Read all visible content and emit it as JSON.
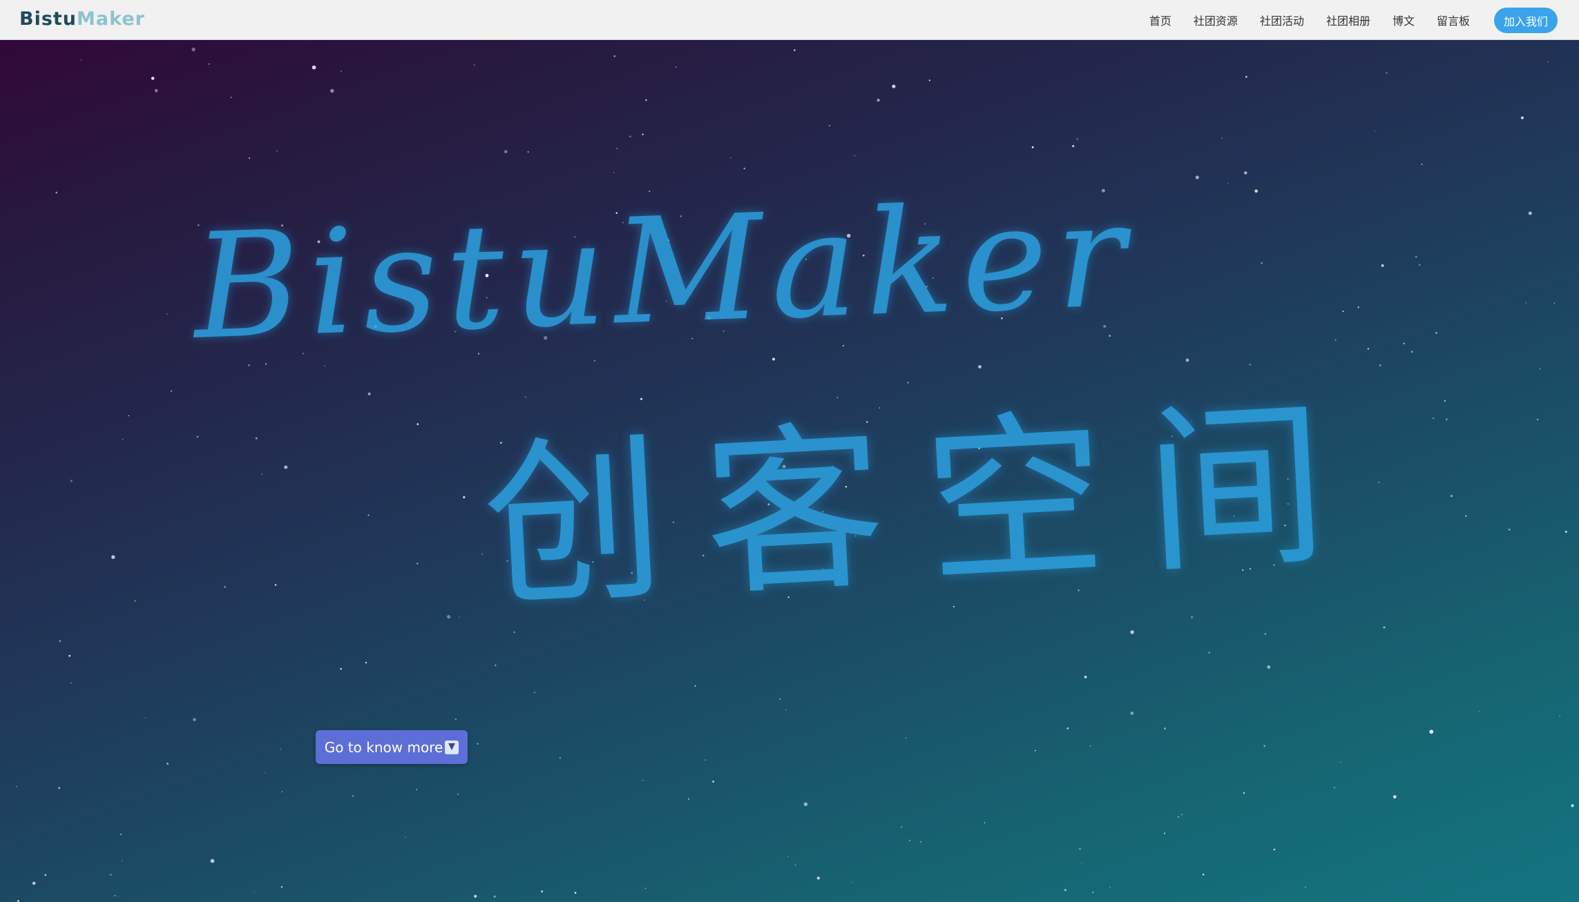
{
  "navbar": {
    "brand_part1": "Bistu",
    "brand_part2": "Maker",
    "links": [
      {
        "label": "首页"
      },
      {
        "label": "社团资源"
      },
      {
        "label": "社团活动"
      },
      {
        "label": "社团相册"
      },
      {
        "label": "博文"
      },
      {
        "label": "留言板"
      }
    ],
    "join_button": "加入我们"
  },
  "hero": {
    "handwriting_en": "BistuMaker",
    "handwriting_zh": "创客空间",
    "cta_button": "Go to know more",
    "cta_icon": "down-arrow-icon"
  },
  "colors": {
    "accent": "#3aa3ea",
    "cta": "#5d6fd6",
    "handwriting": "#2c9fde",
    "gradient_top_left": "#310838",
    "gradient_bottom_right": "#127580"
  }
}
